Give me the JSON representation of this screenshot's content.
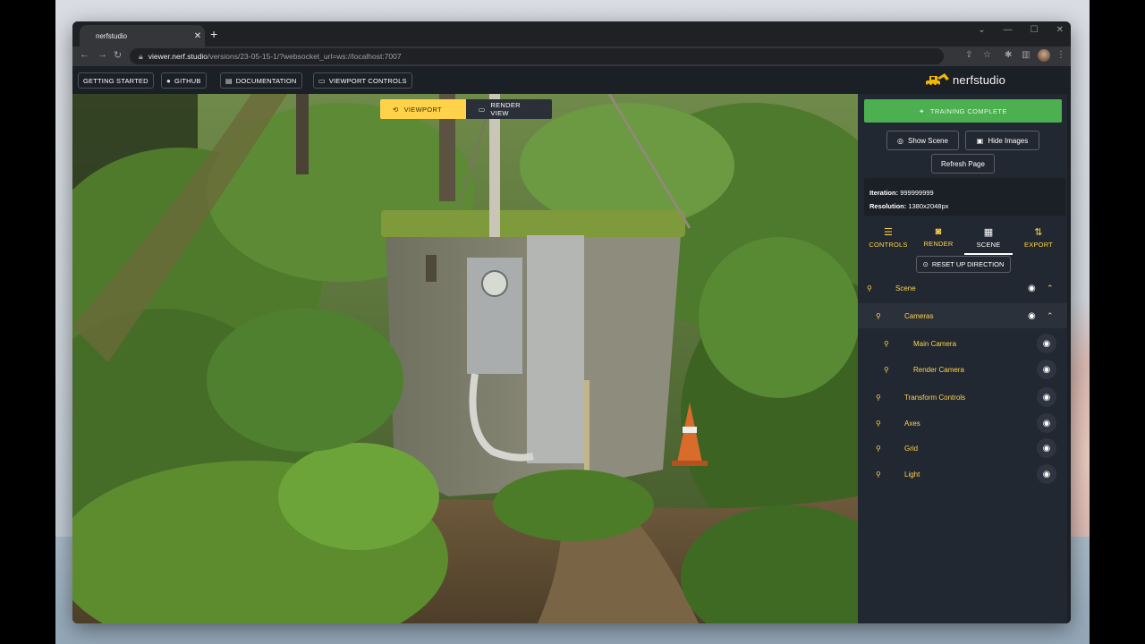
{
  "browser": {
    "tab_title": "nerfstudio",
    "tab_close": "✕",
    "new_tab": "+",
    "url_host": "viewer.nerf.studio",
    "url_path": "/versions/23-05-15-1/?websocket_url=ws://localhost:7007",
    "win_min": "—",
    "win_max": "☐",
    "win_close": "✕"
  },
  "topnav": {
    "getting_started": "GETTING STARTED",
    "github": "GITHUB",
    "documentation": "DOCUMENTATION",
    "viewport_controls": "VIEWPORT CONTROLS",
    "logo_text": "nerfstudio"
  },
  "viewport": {
    "tab_viewport": "VIEWPORT",
    "tab_render_view": "RENDER VIEW"
  },
  "panel": {
    "training_status": "TRAINING COMPLETE",
    "show_scene": "Show Scene",
    "hide_images": "Hide Images",
    "refresh_page": "Refresh Page",
    "iteration_label": "Iteration:",
    "iteration_value": "999999999",
    "resolution_label": "Resolution:",
    "resolution_value": "1380x2048px",
    "tabs": [
      {
        "label": "CONTROLS",
        "icon": "sliders-icon"
      },
      {
        "label": "RENDER",
        "icon": "camera-icon"
      },
      {
        "label": "SCENE",
        "icon": "grid-icon"
      },
      {
        "label": "EXPORT",
        "icon": "swap-vertical-icon"
      }
    ],
    "active_tab": "SCENE",
    "reset_up": "RESET UP DIRECTION",
    "tree": [
      {
        "label": "Scene",
        "level": 0
      },
      {
        "label": "Cameras",
        "level": 1
      },
      {
        "label": "Main Camera",
        "level": 2
      },
      {
        "label": "Render Camera",
        "level": 2
      },
      {
        "label": "Transform Controls",
        "level": 1
      },
      {
        "label": "Axes",
        "level": 1
      },
      {
        "label": "Grid",
        "level": 1
      },
      {
        "label": "Light",
        "level": 1
      }
    ]
  },
  "colors": {
    "accent": "#ffd24a",
    "success": "#4caf50",
    "panel_bg": "#222831",
    "app_bg": "#1b1f26"
  }
}
